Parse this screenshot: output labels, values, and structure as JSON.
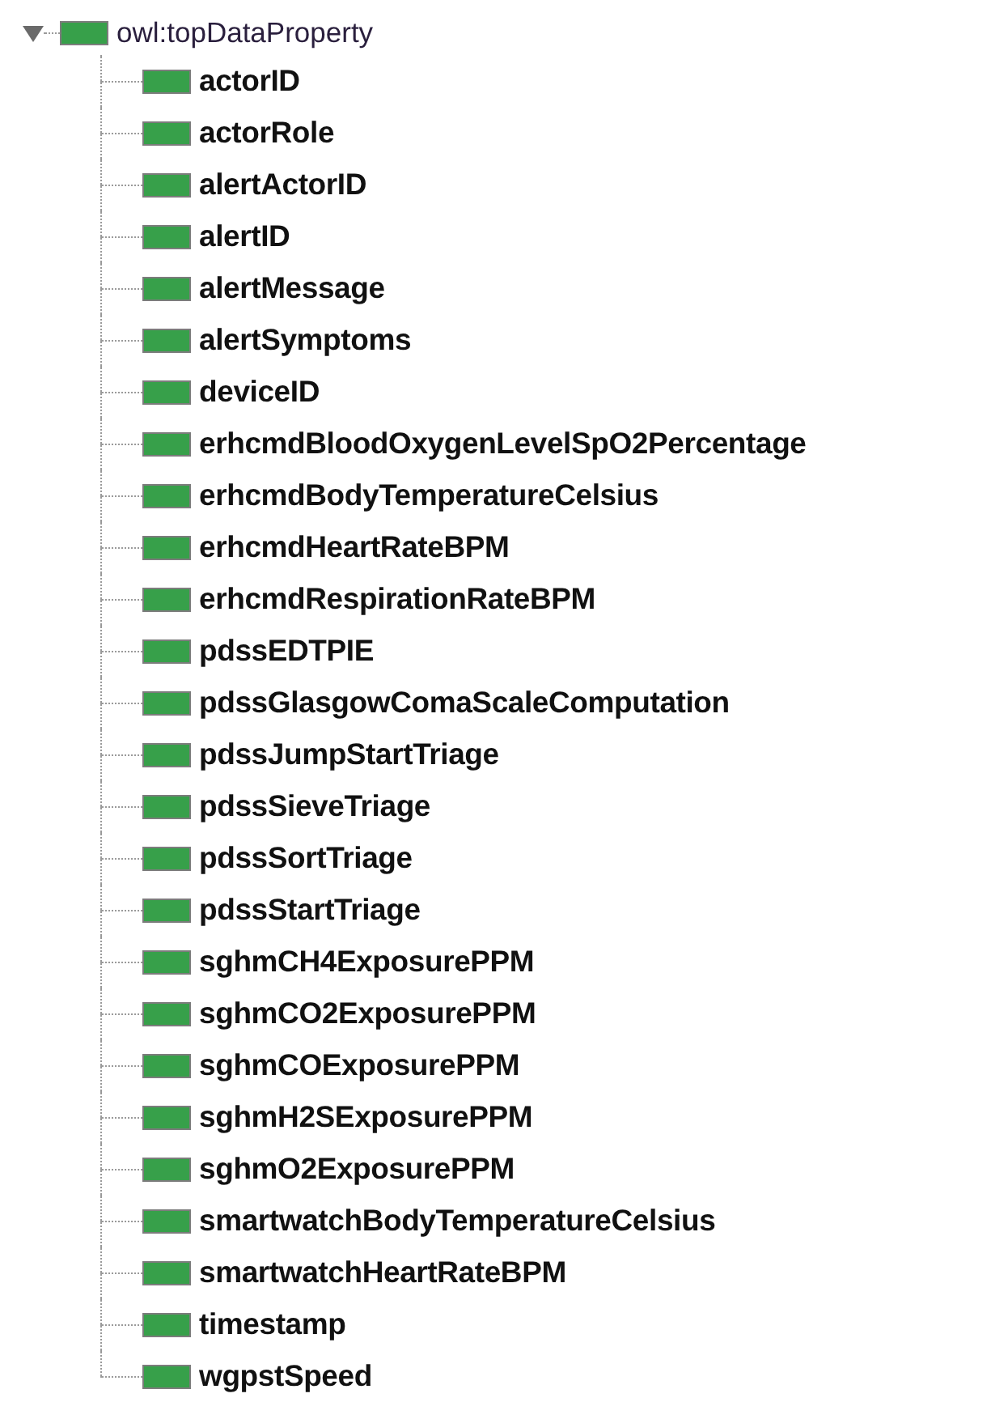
{
  "tree": {
    "label": "owl:topDataProperty",
    "expanded": true,
    "children": [
      {
        "label": "actorID"
      },
      {
        "label": "actorRole"
      },
      {
        "label": "alertActorID"
      },
      {
        "label": "alertID"
      },
      {
        "label": "alertMessage"
      },
      {
        "label": "alertSymptoms"
      },
      {
        "label": "deviceID"
      },
      {
        "label": "erhcmdBloodOxygenLevelSpO2Percentage"
      },
      {
        "label": "erhcmdBodyTemperatureCelsius"
      },
      {
        "label": "erhcmdHeartRateBPM"
      },
      {
        "label": "erhcmdRespirationRateBPM"
      },
      {
        "label": "pdssEDTPIE"
      },
      {
        "label": "pdssGlasgowComaScaleComputation"
      },
      {
        "label": "pdssJumpStartTriage"
      },
      {
        "label": "pdssSieveTriage"
      },
      {
        "label": "pdssSortTriage"
      },
      {
        "label": "pdssStartTriage"
      },
      {
        "label": "sghmCH4ExposurePPM"
      },
      {
        "label": "sghmCO2ExposurePPM"
      },
      {
        "label": "sghmCOExposurePPM"
      },
      {
        "label": "sghmH2SExposurePPM"
      },
      {
        "label": "sghmO2ExposurePPM"
      },
      {
        "label": "smartwatchBodyTemperatureCelsius"
      },
      {
        "label": "smartwatchHeartRateBPM"
      },
      {
        "label": "timestamp"
      },
      {
        "label": "wgpstSpeed"
      }
    ]
  }
}
